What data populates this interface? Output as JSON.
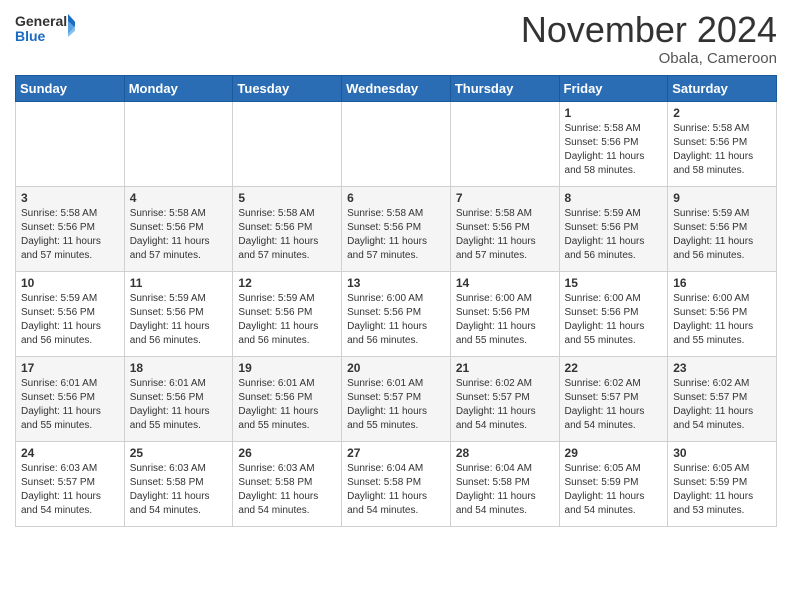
{
  "header": {
    "logo_general": "General",
    "logo_blue": "Blue",
    "month_title": "November 2024",
    "location": "Obala, Cameroon"
  },
  "weekdays": [
    "Sunday",
    "Monday",
    "Tuesday",
    "Wednesday",
    "Thursday",
    "Friday",
    "Saturday"
  ],
  "weeks": [
    [
      {
        "day": "",
        "info": ""
      },
      {
        "day": "",
        "info": ""
      },
      {
        "day": "",
        "info": ""
      },
      {
        "day": "",
        "info": ""
      },
      {
        "day": "",
        "info": ""
      },
      {
        "day": "1",
        "info": "Sunrise: 5:58 AM\nSunset: 5:56 PM\nDaylight: 11 hours\nand 58 minutes."
      },
      {
        "day": "2",
        "info": "Sunrise: 5:58 AM\nSunset: 5:56 PM\nDaylight: 11 hours\nand 58 minutes."
      }
    ],
    [
      {
        "day": "3",
        "info": "Sunrise: 5:58 AM\nSunset: 5:56 PM\nDaylight: 11 hours\nand 57 minutes."
      },
      {
        "day": "4",
        "info": "Sunrise: 5:58 AM\nSunset: 5:56 PM\nDaylight: 11 hours\nand 57 minutes."
      },
      {
        "day": "5",
        "info": "Sunrise: 5:58 AM\nSunset: 5:56 PM\nDaylight: 11 hours\nand 57 minutes."
      },
      {
        "day": "6",
        "info": "Sunrise: 5:58 AM\nSunset: 5:56 PM\nDaylight: 11 hours\nand 57 minutes."
      },
      {
        "day": "7",
        "info": "Sunrise: 5:58 AM\nSunset: 5:56 PM\nDaylight: 11 hours\nand 57 minutes."
      },
      {
        "day": "8",
        "info": "Sunrise: 5:59 AM\nSunset: 5:56 PM\nDaylight: 11 hours\nand 56 minutes."
      },
      {
        "day": "9",
        "info": "Sunrise: 5:59 AM\nSunset: 5:56 PM\nDaylight: 11 hours\nand 56 minutes."
      }
    ],
    [
      {
        "day": "10",
        "info": "Sunrise: 5:59 AM\nSunset: 5:56 PM\nDaylight: 11 hours\nand 56 minutes."
      },
      {
        "day": "11",
        "info": "Sunrise: 5:59 AM\nSunset: 5:56 PM\nDaylight: 11 hours\nand 56 minutes."
      },
      {
        "day": "12",
        "info": "Sunrise: 5:59 AM\nSunset: 5:56 PM\nDaylight: 11 hours\nand 56 minutes."
      },
      {
        "day": "13",
        "info": "Sunrise: 6:00 AM\nSunset: 5:56 PM\nDaylight: 11 hours\nand 56 minutes."
      },
      {
        "day": "14",
        "info": "Sunrise: 6:00 AM\nSunset: 5:56 PM\nDaylight: 11 hours\nand 55 minutes."
      },
      {
        "day": "15",
        "info": "Sunrise: 6:00 AM\nSunset: 5:56 PM\nDaylight: 11 hours\nand 55 minutes."
      },
      {
        "day": "16",
        "info": "Sunrise: 6:00 AM\nSunset: 5:56 PM\nDaylight: 11 hours\nand 55 minutes."
      }
    ],
    [
      {
        "day": "17",
        "info": "Sunrise: 6:01 AM\nSunset: 5:56 PM\nDaylight: 11 hours\nand 55 minutes."
      },
      {
        "day": "18",
        "info": "Sunrise: 6:01 AM\nSunset: 5:56 PM\nDaylight: 11 hours\nand 55 minutes."
      },
      {
        "day": "19",
        "info": "Sunrise: 6:01 AM\nSunset: 5:56 PM\nDaylight: 11 hours\nand 55 minutes."
      },
      {
        "day": "20",
        "info": "Sunrise: 6:01 AM\nSunset: 5:57 PM\nDaylight: 11 hours\nand 55 minutes."
      },
      {
        "day": "21",
        "info": "Sunrise: 6:02 AM\nSunset: 5:57 PM\nDaylight: 11 hours\nand 54 minutes."
      },
      {
        "day": "22",
        "info": "Sunrise: 6:02 AM\nSunset: 5:57 PM\nDaylight: 11 hours\nand 54 minutes."
      },
      {
        "day": "23",
        "info": "Sunrise: 6:02 AM\nSunset: 5:57 PM\nDaylight: 11 hours\nand 54 minutes."
      }
    ],
    [
      {
        "day": "24",
        "info": "Sunrise: 6:03 AM\nSunset: 5:57 PM\nDaylight: 11 hours\nand 54 minutes."
      },
      {
        "day": "25",
        "info": "Sunrise: 6:03 AM\nSunset: 5:58 PM\nDaylight: 11 hours\nand 54 minutes."
      },
      {
        "day": "26",
        "info": "Sunrise: 6:03 AM\nSunset: 5:58 PM\nDaylight: 11 hours\nand 54 minutes."
      },
      {
        "day": "27",
        "info": "Sunrise: 6:04 AM\nSunset: 5:58 PM\nDaylight: 11 hours\nand 54 minutes."
      },
      {
        "day": "28",
        "info": "Sunrise: 6:04 AM\nSunset: 5:58 PM\nDaylight: 11 hours\nand 54 minutes."
      },
      {
        "day": "29",
        "info": "Sunrise: 6:05 AM\nSunset: 5:59 PM\nDaylight: 11 hours\nand 54 minutes."
      },
      {
        "day": "30",
        "info": "Sunrise: 6:05 AM\nSunset: 5:59 PM\nDaylight: 11 hours\nand 53 minutes."
      }
    ]
  ]
}
